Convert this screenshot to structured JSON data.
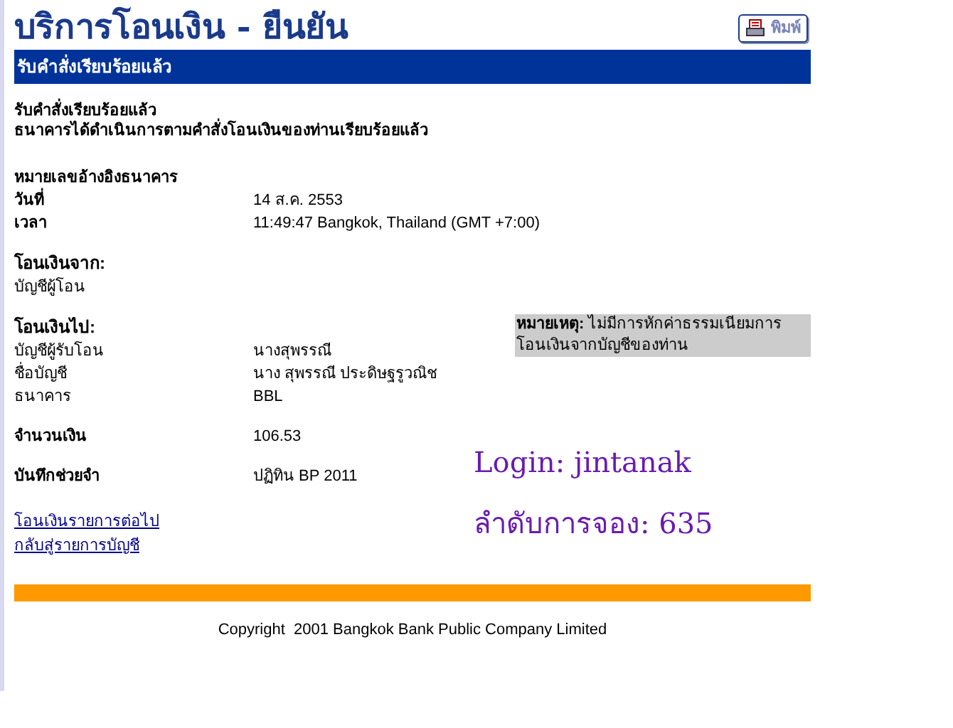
{
  "page_title": "บริการโอนเงิน - ยืนยัน",
  "print_button": {
    "label": "พิมพ์"
  },
  "banner": "รับคำสั่งเรียบร้อยแล้ว",
  "confirmation": [
    "รับคำสั่งเรียบร้อยแล้ว",
    "ธนาคารได้ดำเนินการตามคำสั่งโอนเงินของท่านเรียบร้อยแล้ว"
  ],
  "sections": [
    {
      "rows": [
        {
          "label": "หมายเลขอ้างอิงธนาคาร",
          "bold": true
        },
        {
          "label": "วันที่",
          "bold": true,
          "value": "14 ส.ค. 2553"
        },
        {
          "label": "เวลา",
          "bold": true,
          "value": "11:49:47 Bangkok, Thailand (GMT +7:00)"
        }
      ]
    },
    {
      "heading": "โอนเงินจาก:",
      "rows": [
        {
          "label": "บัญชีผู้โอน",
          "bold": false
        }
      ]
    },
    {
      "heading": "โอนเงินไป:",
      "rows": [
        {
          "label": "บัญชีผู้รับโอน",
          "bold": false,
          "value": "นางสุพรรณี"
        },
        {
          "label": "ชื่อบัญชี",
          "bold": false,
          "value": "นาง สุพรรณี ประดิษฐรูวณิช"
        },
        {
          "label": "ธนาคาร",
          "bold": false,
          "value": "BBL"
        }
      ]
    },
    {
      "rows": [
        {
          "label": "จำนวนเงิน",
          "bold": true,
          "value": "106.53"
        }
      ]
    },
    {
      "rows": [
        {
          "label": "บันทึกช่วยจำ",
          "bold": true,
          "value": "ปฏิทิน BP 2011"
        }
      ]
    }
  ],
  "note": "**หมายเหตุ:** ไม่มีการหักค่าธรรมเนียมการโอนเงินจากบัญชีของท่าน",
  "overlay": [
    "Login: jintanak",
    "ลำดับการจอง: 635"
  ],
  "links": [
    "โอนเงินรายการต่อไป",
    "กลับสู่รายการบัญชี"
  ],
  "copyright": "Copyright  2001 Bangkok Bank Public Company Limited"
}
